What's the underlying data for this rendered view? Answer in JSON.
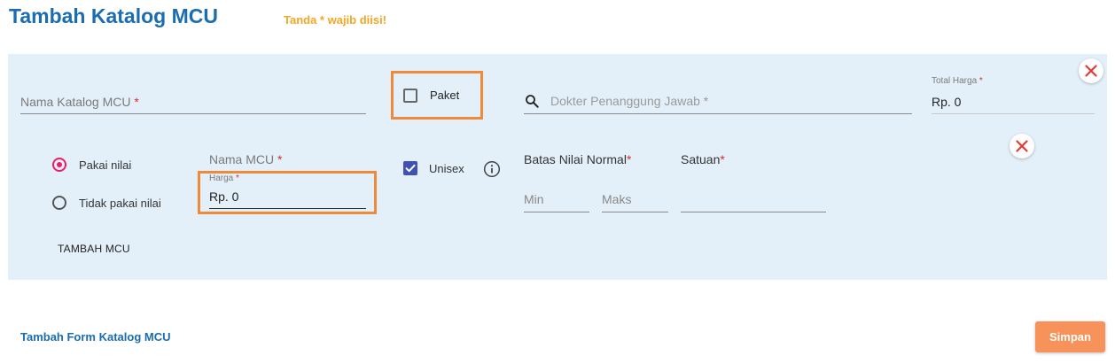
{
  "header": {
    "title": "Tambah Katalog MCU",
    "required_note": "Tanda * wajib diisi!"
  },
  "catalog_form": {
    "name_field": {
      "label": "Nama Katalog MCU",
      "required_mark": "*"
    },
    "package_checkbox": {
      "label": "Paket",
      "checked": false
    },
    "doctor_field": {
      "placeholder": "Dokter Penanggung Jawab *"
    },
    "total_price": {
      "label": "Total Harga",
      "required_mark": "*",
      "value": "Rp. 0"
    },
    "remove_icon": "close-icon"
  },
  "mcu_item": {
    "value_mode": {
      "options": [
        "Pakai nilai",
        "Tidak pakai nilai"
      ],
      "selected": "Pakai nilai"
    },
    "mcu_name": {
      "label": "Nama MCU",
      "required_mark": "*"
    },
    "price": {
      "label": "Harga",
      "required_mark": "*",
      "value": "Rp. 0"
    },
    "unisex": {
      "label": "Unisex",
      "checked": true
    },
    "info_icon": "info-icon",
    "normal_range": {
      "label": "Batas Nilai Normal",
      "required_mark": "*",
      "min_placeholder": "Min",
      "max_placeholder": "Maks"
    },
    "unit": {
      "label": "Satuan",
      "required_mark": "*"
    },
    "add_button": "TAMBAH MCU",
    "remove_icon": "close-icon"
  },
  "footer": {
    "add_form_link": "Tambah Form Katalog MCU",
    "save_button": "Simpan"
  },
  "colors": {
    "title_blue": "#1a6db0",
    "note_orange": "#f5a623",
    "panel_bg": "#e3f0fa",
    "highlight_orange": "#f08a3b",
    "radio_pink": "#e91e63",
    "checkbox_indigo": "#3f51b5",
    "close_red": "#e53935",
    "save_button": "#f7935a"
  }
}
